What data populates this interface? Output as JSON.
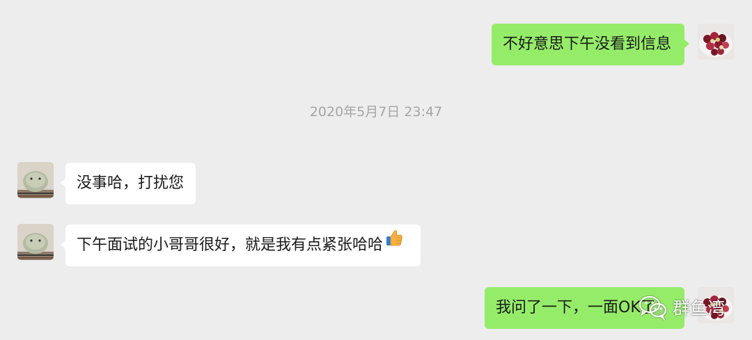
{
  "timestamp": "2020年5月7日 23:47",
  "messages": [
    {
      "sender": "me",
      "text": "不好意思下午没看到信息"
    },
    {
      "sender": "peer",
      "text": "没事哈，打扰您"
    },
    {
      "sender": "peer",
      "text": "下午面试的小哥哥很好，就是我有点紧张哈哈",
      "emoji": "thumbs-up-icon"
    },
    {
      "sender": "me",
      "text": "我问了一下，一面OK了"
    }
  ],
  "watermark": {
    "icon": "wechat-icon",
    "text": "群鱼湾"
  },
  "colors": {
    "background": "#ededed",
    "my_bubble": "#95ec69",
    "peer_bubble": "#ffffff",
    "timestamp_text": "#a5a5a5"
  }
}
